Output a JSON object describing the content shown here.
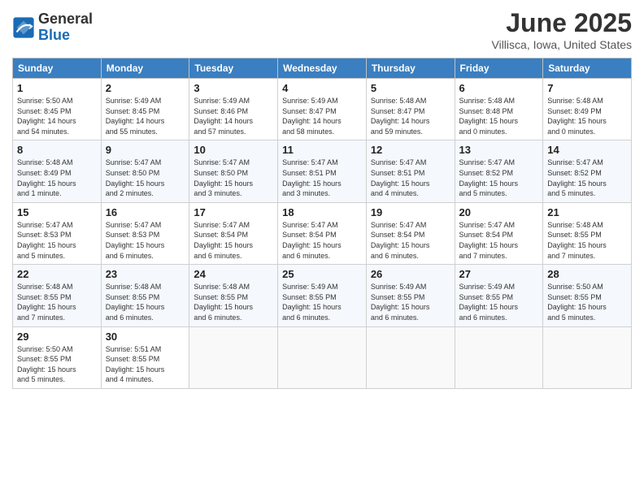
{
  "header": {
    "logo_general": "General",
    "logo_blue": "Blue",
    "month": "June 2025",
    "location": "Villisca, Iowa, United States"
  },
  "weekdays": [
    "Sunday",
    "Monday",
    "Tuesday",
    "Wednesday",
    "Thursday",
    "Friday",
    "Saturday"
  ],
  "weeks": [
    [
      {
        "day": "1",
        "info": "Sunrise: 5:50 AM\nSunset: 8:45 PM\nDaylight: 14 hours\nand 54 minutes."
      },
      {
        "day": "2",
        "info": "Sunrise: 5:49 AM\nSunset: 8:45 PM\nDaylight: 14 hours\nand 55 minutes."
      },
      {
        "day": "3",
        "info": "Sunrise: 5:49 AM\nSunset: 8:46 PM\nDaylight: 14 hours\nand 57 minutes."
      },
      {
        "day": "4",
        "info": "Sunrise: 5:49 AM\nSunset: 8:47 PM\nDaylight: 14 hours\nand 58 minutes."
      },
      {
        "day": "5",
        "info": "Sunrise: 5:48 AM\nSunset: 8:47 PM\nDaylight: 14 hours\nand 59 minutes."
      },
      {
        "day": "6",
        "info": "Sunrise: 5:48 AM\nSunset: 8:48 PM\nDaylight: 15 hours\nand 0 minutes."
      },
      {
        "day": "7",
        "info": "Sunrise: 5:48 AM\nSunset: 8:49 PM\nDaylight: 15 hours\nand 0 minutes."
      }
    ],
    [
      {
        "day": "8",
        "info": "Sunrise: 5:48 AM\nSunset: 8:49 PM\nDaylight: 15 hours\nand 1 minute."
      },
      {
        "day": "9",
        "info": "Sunrise: 5:47 AM\nSunset: 8:50 PM\nDaylight: 15 hours\nand 2 minutes."
      },
      {
        "day": "10",
        "info": "Sunrise: 5:47 AM\nSunset: 8:50 PM\nDaylight: 15 hours\nand 3 minutes."
      },
      {
        "day": "11",
        "info": "Sunrise: 5:47 AM\nSunset: 8:51 PM\nDaylight: 15 hours\nand 3 minutes."
      },
      {
        "day": "12",
        "info": "Sunrise: 5:47 AM\nSunset: 8:51 PM\nDaylight: 15 hours\nand 4 minutes."
      },
      {
        "day": "13",
        "info": "Sunrise: 5:47 AM\nSunset: 8:52 PM\nDaylight: 15 hours\nand 5 minutes."
      },
      {
        "day": "14",
        "info": "Sunrise: 5:47 AM\nSunset: 8:52 PM\nDaylight: 15 hours\nand 5 minutes."
      }
    ],
    [
      {
        "day": "15",
        "info": "Sunrise: 5:47 AM\nSunset: 8:53 PM\nDaylight: 15 hours\nand 5 minutes."
      },
      {
        "day": "16",
        "info": "Sunrise: 5:47 AM\nSunset: 8:53 PM\nDaylight: 15 hours\nand 6 minutes."
      },
      {
        "day": "17",
        "info": "Sunrise: 5:47 AM\nSunset: 8:54 PM\nDaylight: 15 hours\nand 6 minutes."
      },
      {
        "day": "18",
        "info": "Sunrise: 5:47 AM\nSunset: 8:54 PM\nDaylight: 15 hours\nand 6 minutes."
      },
      {
        "day": "19",
        "info": "Sunrise: 5:47 AM\nSunset: 8:54 PM\nDaylight: 15 hours\nand 6 minutes."
      },
      {
        "day": "20",
        "info": "Sunrise: 5:47 AM\nSunset: 8:54 PM\nDaylight: 15 hours\nand 7 minutes."
      },
      {
        "day": "21",
        "info": "Sunrise: 5:48 AM\nSunset: 8:55 PM\nDaylight: 15 hours\nand 7 minutes."
      }
    ],
    [
      {
        "day": "22",
        "info": "Sunrise: 5:48 AM\nSunset: 8:55 PM\nDaylight: 15 hours\nand 7 minutes."
      },
      {
        "day": "23",
        "info": "Sunrise: 5:48 AM\nSunset: 8:55 PM\nDaylight: 15 hours\nand 6 minutes."
      },
      {
        "day": "24",
        "info": "Sunrise: 5:48 AM\nSunset: 8:55 PM\nDaylight: 15 hours\nand 6 minutes."
      },
      {
        "day": "25",
        "info": "Sunrise: 5:49 AM\nSunset: 8:55 PM\nDaylight: 15 hours\nand 6 minutes."
      },
      {
        "day": "26",
        "info": "Sunrise: 5:49 AM\nSunset: 8:55 PM\nDaylight: 15 hours\nand 6 minutes."
      },
      {
        "day": "27",
        "info": "Sunrise: 5:49 AM\nSunset: 8:55 PM\nDaylight: 15 hours\nand 6 minutes."
      },
      {
        "day": "28",
        "info": "Sunrise: 5:50 AM\nSunset: 8:55 PM\nDaylight: 15 hours\nand 5 minutes."
      }
    ],
    [
      {
        "day": "29",
        "info": "Sunrise: 5:50 AM\nSunset: 8:55 PM\nDaylight: 15 hours\nand 5 minutes."
      },
      {
        "day": "30",
        "info": "Sunrise: 5:51 AM\nSunset: 8:55 PM\nDaylight: 15 hours\nand 4 minutes."
      },
      {
        "day": "",
        "info": ""
      },
      {
        "day": "",
        "info": ""
      },
      {
        "day": "",
        "info": ""
      },
      {
        "day": "",
        "info": ""
      },
      {
        "day": "",
        "info": ""
      }
    ]
  ]
}
